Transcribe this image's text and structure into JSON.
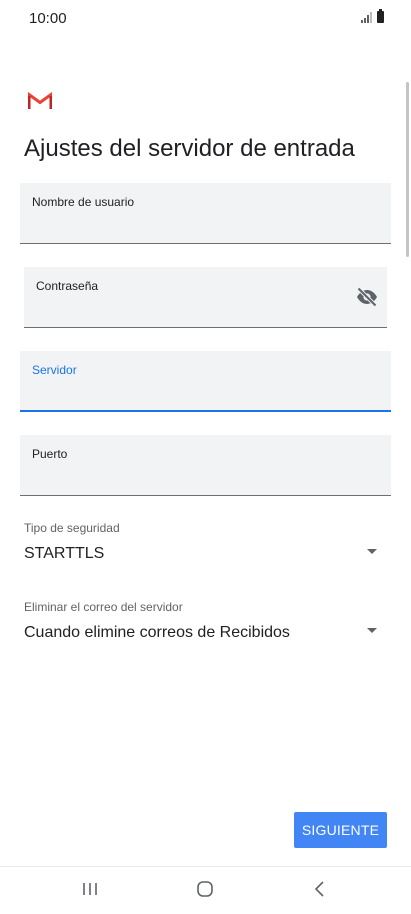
{
  "status_bar": {
    "time": "10:00"
  },
  "app": {
    "logo": "gmail-logo",
    "title": "Ajustes del servidor de entrada"
  },
  "form": {
    "username": {
      "label": "Nombre de usuario",
      "value": ""
    },
    "password": {
      "label": "Contraseña",
      "value": "",
      "toggle_icon": "eye-off-icon"
    },
    "server": {
      "label": "Servidor",
      "value": "",
      "focused": true
    },
    "port": {
      "label": "Puerto",
      "value": ""
    },
    "security_type": {
      "label": "Tipo de seguridad",
      "value": "STARTTLS"
    },
    "delete_from_server": {
      "label": "Eliminar el correo del servidor",
      "value": "Cuando elimine correos de Recibidos"
    }
  },
  "actions": {
    "next_label": "SIGUIENTE"
  },
  "navigation": {
    "recents": "recents-icon",
    "home": "home-icon",
    "back": "back-icon"
  },
  "colors": {
    "accent": "#1a73e8",
    "button": "#4285f4",
    "field_bg": "#f1f3f4",
    "gmail_red": "#ea4335"
  }
}
